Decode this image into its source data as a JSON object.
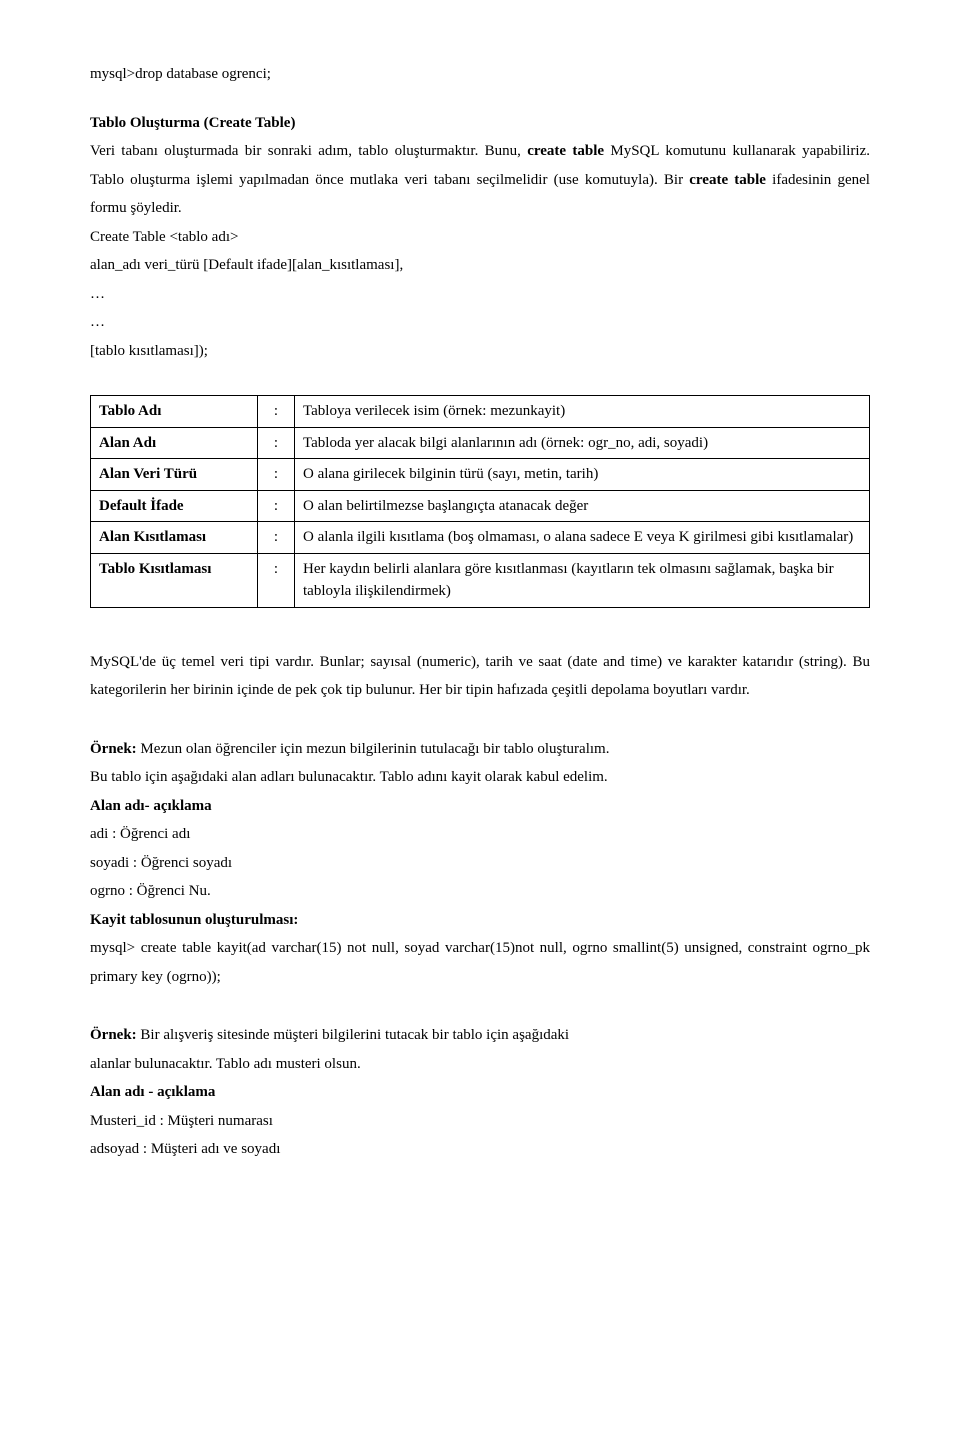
{
  "line1": "mysql>drop database ogrenci;",
  "sec1_title": "Tablo Oluşturma (Create Table)",
  "sec1_p1a": "Veri tabanı oluşturmada bir sonraki adım, tablo oluşturmaktır. Bunu, ",
  "sec1_p1b": "create table",
  "sec1_p1c": " MySQL komutunu kullanarak yapabiliriz. Tablo oluşturma işlemi yapılmadan önce mutlaka veri tabanı seçilmelidir (use komutuyla). Bir ",
  "sec1_p1d": "create table",
  "sec1_p1e": " ifadesinin genel formu şöyledir.",
  "sec1_l1": "Create Table <tablo adı>",
  "sec1_l2": "alan_adı veri_türü [Default ifade][alan_kısıtlaması],",
  "sec1_l3": "…",
  "sec1_l4": "…",
  "sec1_l5": "[tablo kısıtlaması]);",
  "table": [
    {
      "label": "Tablo Adı",
      "desc": "Tabloya verilecek isim (örnek: mezunkayit)"
    },
    {
      "label": "Alan Adı",
      "desc": "Tabloda yer alacak bilgi alanlarının adı (örnek: ogr_no, adi, soyadi)"
    },
    {
      "label": "Alan Veri Türü",
      "desc": "O alana girilecek bilginin türü (sayı, metin, tarih)"
    },
    {
      "label": "Default İfade",
      "desc": "O alan belirtilmezse başlangıçta atanacak değer"
    },
    {
      "label": "Alan Kısıtlaması",
      "desc": "O alanla ilgili kısıtlama (boş olmaması, o alana sadece E veya K girilmesi gibi kısıtlamalar)"
    },
    {
      "label": "Tablo Kısıtlaması",
      "desc": "Her kaydın belirli alanlara göre kısıtlanması (kayıtların tek olmasını sağlamak, başka bir tabloyla ilişkilendirmek)"
    }
  ],
  "sec2_p": "MySQL'de üç temel veri tipi vardır. Bunlar; sayısal (numeric), tarih ve saat (date and time) ve karakter katarıdır (string). Bu kategorilerin her birinin içinde de pek çok tip bulunur. Her bir tipin hafızada çeşitli depolama boyutları vardır.",
  "ex1_lbl": "Örnek:",
  "ex1_a": " Mezun olan öğrenciler için mezun bilgilerinin tutulacağı bir tablo oluşturalım.",
  "ex1_b": "Bu tablo için aşağıdaki alan adları bulunacaktır. Tablo adını kayit olarak kabul edelim.",
  "ex1_c": "Alan adı- açıklama",
  "ex1_d": "adi : Öğrenci adı",
  "ex1_e": "soyadi : Öğrenci soyadı",
  "ex1_f": "ogrno : Öğrenci Nu.",
  "ex1_g": "Kayit tablosunun oluşturulması:",
  "ex1_h": "mysql> create table kayit(ad varchar(15) not null, soyad varchar(15)not null, ogrno smallint(5) unsigned, constraint ogrno_pk primary key (ogrno));",
  "ex2_lbl": "Örnek:",
  "ex2_a": " Bir alışveriş sitesinde müşteri bilgilerini tutacak bir tablo için aşağıdaki",
  "ex2_b": "alanlar bulunacaktır. Tablo adı musteri olsun.",
  "ex2_c": "Alan adı - açıklama",
  "ex2_d": "Musteri_id : Müşteri numarası",
  "ex2_e": "adsoyad : Müşteri adı ve soyadı"
}
